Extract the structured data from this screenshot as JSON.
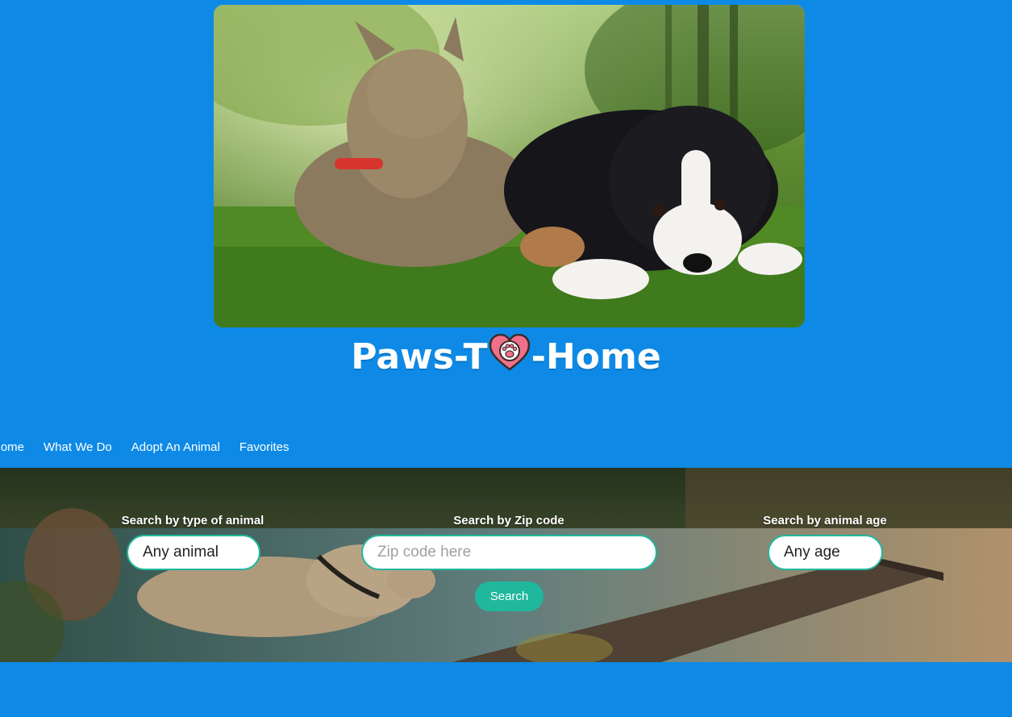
{
  "brand": {
    "logo_before": "Paws-T",
    "logo_after": "-Home"
  },
  "hero": {
    "image_alt": "cat-and-puppy-on-grass"
  },
  "nav": {
    "items": [
      {
        "label": "Home"
      },
      {
        "label": "What We Do"
      },
      {
        "label": "Adopt An Animal"
      },
      {
        "label": "Favorites"
      }
    ]
  },
  "search": {
    "type_label": "Search by type of animal",
    "type_value": "Any animal",
    "zip_label": "Search by Zip code",
    "zip_placeholder": "Zip code here",
    "age_label": "Search by animal age",
    "age_value": "Any age",
    "button_label": "Search"
  },
  "colors": {
    "page_background": "#0e8ae6",
    "accent": "#1fb89c",
    "logo_heart": "#f0708a"
  },
  "icons": [
    "paw-heart-icon"
  ]
}
